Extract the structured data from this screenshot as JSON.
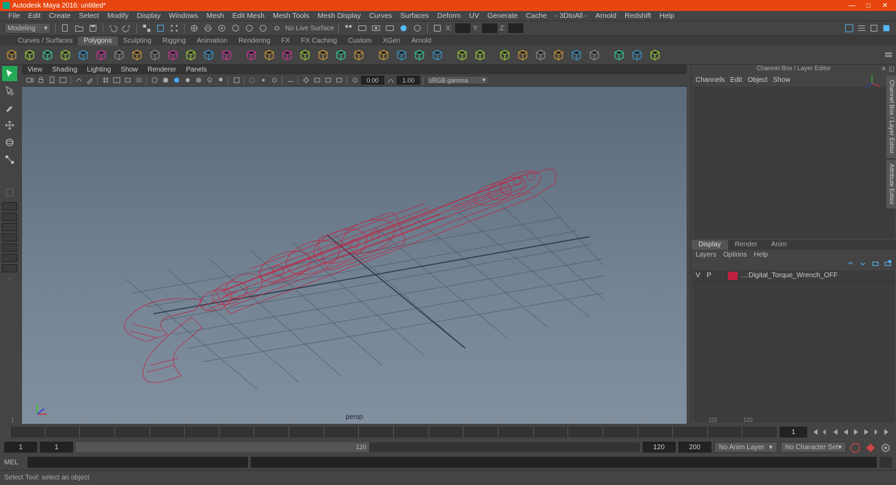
{
  "title": "Autodesk Maya 2016: untitled*",
  "menubar": [
    "File",
    "Edit",
    "Create",
    "Select",
    "Modify",
    "Display",
    "Windows",
    "Mesh",
    "Edit Mesh",
    "Mesh Tools",
    "Mesh Display",
    "Curves",
    "Surfaces",
    "Deform",
    "UV",
    "Generate",
    "Cache",
    "- 3DtoAll -",
    "Arnold",
    "Redshift",
    "Help"
  ],
  "workspace": "Modeling",
  "live_label": "No Live Surface",
  "axis_labels": {
    "x": "X:",
    "y": "Y:",
    "z": "Z:"
  },
  "shelf_tabs": [
    "Curves / Surfaces",
    "Polygons",
    "Sculpting",
    "Rigging",
    "Animation",
    "Rendering",
    "FX",
    "FX Caching",
    "Custom",
    "XGen",
    "Arnold"
  ],
  "shelf_active": 1,
  "panel_menu": [
    "View",
    "Shading",
    "Lighting",
    "Show",
    "Renderer",
    "Panels"
  ],
  "panel_fields": {
    "a": "0.00",
    "b": "1.00"
  },
  "colorspace": "sRGB gamma",
  "view_label": "persp",
  "channelbox": {
    "title": "Channel Box / Layer Editor",
    "menu": [
      "Channels",
      "Edit",
      "Object",
      "Show"
    ]
  },
  "vtabs": [
    "Channel Box / Layer Editor",
    "Attribute Editor"
  ],
  "layer_tabs": [
    "Display",
    "Render",
    "Anim"
  ],
  "layer_tabs_active": 0,
  "layer_menu": [
    "Layers",
    "Options",
    "Help"
  ],
  "layer": {
    "v": "V",
    "p": "P",
    "name": "...:Digital_Torque_Wrench_OFF"
  },
  "timeline_ticks": [
    "1",
    "10",
    "20",
    "30",
    "35",
    "40",
    "45",
    "50",
    "55",
    "60",
    "65",
    "70",
    "75",
    "80",
    "85",
    "90",
    "95",
    "100",
    "105",
    "110",
    "115",
    "120"
  ],
  "current_frame": "1",
  "range": {
    "start": "1",
    "start2": "1",
    "thumb": "120",
    "end": "120",
    "end2": "200"
  },
  "animlayer": "No Anim Layer",
  "charset": "No Character Set",
  "cmd_label": "MEL",
  "help": "Select Tool: select an object"
}
